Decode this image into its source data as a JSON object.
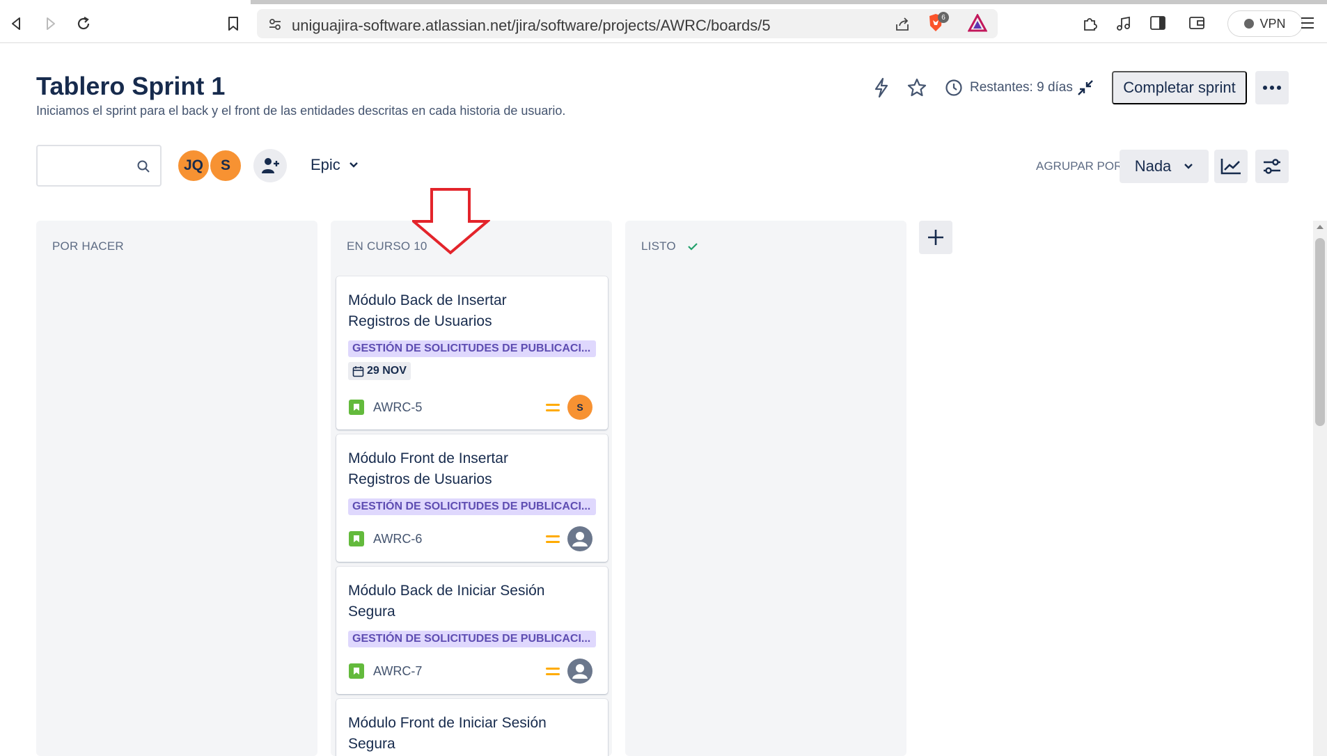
{
  "browser": {
    "url_host": "uniguajira-software.atlassian.net",
    "url_path": "/jira/software/projects/AWRC/boards/5",
    "brave_badge": "6",
    "vpn_label": "VPN"
  },
  "header": {
    "title": "Tablero Sprint 1",
    "subtitle": "Iniciamos el sprint para el back y el front de las entidades descritas en cada historia de usuario.",
    "remaining": "Restantes: 9 días",
    "complete_sprint": "Completar sprint"
  },
  "filters": {
    "search_value": "",
    "avatars": [
      "JQ",
      "S"
    ],
    "epic_label": "Epic",
    "group_by_label": "AGRUPAR POR",
    "group_by_value": "Nada"
  },
  "columns": [
    {
      "title": "POR HACER",
      "count": ""
    },
    {
      "title": "EN CURSO",
      "count": "10"
    },
    {
      "title": "LISTO",
      "count": ""
    }
  ],
  "cards": [
    {
      "title": "Módulo Back de Insertar Registros de Usuarios",
      "epic": "GESTIÓN DE SOLICITUDES DE PUBLICACI...",
      "date": "29 NOV",
      "key": "AWRC-5",
      "priority": "medium",
      "assignee": "S"
    },
    {
      "title": "Módulo Front de Insertar Registros de Usuarios",
      "epic": "GESTIÓN DE SOLICITUDES DE PUBLICACI...",
      "date": "",
      "key": "AWRC-6",
      "priority": "medium",
      "assignee": ""
    },
    {
      "title": "Módulo Back de Iniciar Sesión Segura",
      "epic": "GESTIÓN DE SOLICITUDES DE PUBLICACI...",
      "date": "",
      "key": "AWRC-7",
      "priority": "medium",
      "assignee": ""
    },
    {
      "title": "Módulo Front de Iniciar Sesión Segura",
      "epic": "",
      "date": "",
      "key": "",
      "priority": "",
      "assignee": ""
    }
  ],
  "colors": {
    "epic_bg": "#dfd8fd",
    "epic_text": "#5e4db2",
    "story_green": "#63ba3c",
    "priority_medium": "#ffab00",
    "avatar_orange": "#f79232",
    "done_check": "#22a06b",
    "arrow_red": "#e3242b"
  }
}
